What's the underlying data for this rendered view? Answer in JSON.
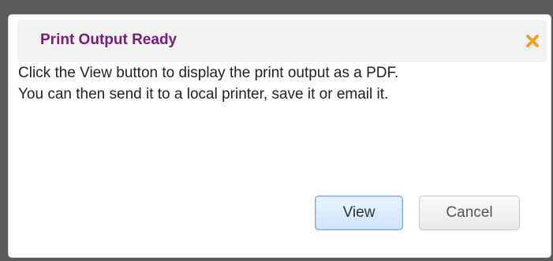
{
  "dialog": {
    "title": "Print Output Ready",
    "close_icon": "close-icon",
    "message_lines": [
      "Click the View button to display the print output as a PDF.",
      "You can then send it to a local printer, save it or email it."
    ],
    "buttons": {
      "view_label": "View",
      "cancel_label": "Cancel"
    }
  },
  "colors": {
    "title": "#7a1d78",
    "close_icon": "#f0a020",
    "backdrop": "#5b5b5b"
  }
}
